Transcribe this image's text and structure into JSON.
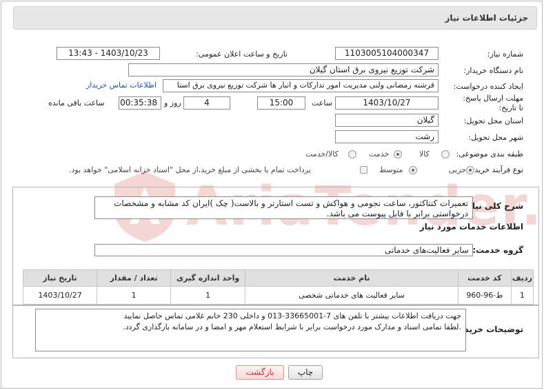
{
  "header": {
    "title": "جزئیات اطلاعات نیاز"
  },
  "form": {
    "need_number_label": "شماره نیاز:",
    "need_number": "1103005104000347",
    "announce_label": "تاریخ و ساعت اعلان عمومی:",
    "announce_value": "1403/10/23 - 13:43",
    "buyer_org_label": "نام دستگاه خریدار:",
    "buyer_org": "شرکت توزیع نیروی برق استان گیلان",
    "creator_label": "ایجاد کننده درخواست:",
    "creator": "فرشته رمضانی ولنی مدیریت امور تدارکات و انبار ها شرکت توزیع نیروی برق استا",
    "contact_link": "اطلاعات تماس خریدار",
    "deadline_label": "مهلت ارسال پاسخ: تا تاریخ:",
    "deadline_date": "1403/10/27",
    "time_label": "ساعت",
    "deadline_time": "15:00",
    "days_value": "4",
    "days_label": "روز و",
    "remaining_time": "00:35:38",
    "remaining_label": "ساعت باقی مانده",
    "province_label": "استان محل تحویل:",
    "province": "گیلان",
    "city_label": "شهر محل تحویل:",
    "city": "رشت",
    "category_label": "طبقه بندی موضوعی:",
    "category_options": [
      "کالا",
      "خدمت",
      "کالا/خدمت"
    ],
    "category_selected": "خدمت",
    "process_label": "نوع فرآیند خرید :",
    "process_options": [
      "جزیی",
      "متوسط"
    ],
    "process_selected": "جزیی",
    "treasury_note": "پرداخت تمام یا بخشی از مبلغ خرید،از محل \"اسناد خزانه اسلامی\" خواهد بود."
  },
  "summary": {
    "label": "شرح کلی نیاز:",
    "text": "تعمیرات کنتاکتور، ساعت نجومی و هواکش و تست استارتر و بالاست( چک )ایران کد مشابه و مشخصات درخواستی برابر با فایل پیوست می باشد."
  },
  "services": {
    "section_title": "اطلاعات خدمات مورد نیاز",
    "group_label": "گروه خدمت:",
    "group_value": "سایر فعالیت‌های خدماتی",
    "columns": [
      "ردیف",
      "کد خدمت",
      "نام خدمت",
      "واحد اندازه گیری",
      "تعداد / مقدار",
      "تاریخ نیاز"
    ],
    "rows": [
      [
        "1",
        "ط-96-960",
        "سایر فعالیت های خدماتی شخصی",
        "1",
        "1",
        "1403/10/27"
      ]
    ]
  },
  "buyer_notes": {
    "label": "توضیحات خریدار:",
    "line1": "جهت دریافت اطلاعات بیشتر با تلفن های 7-33665001-013 و داخلی 230 خانم غلامی تماس حاصل نمایید",
    "line2": ".لطفا تمامی اسناد و مدارک مورد درخواست برابر با شرایط استعلام مهر و امضا و در سامانه بارگذاری گردد."
  },
  "buttons": {
    "print": "چاپ",
    "back": "بازگشت"
  },
  "watermark": {
    "text": "AriaTender.neT"
  },
  "colors": {
    "link": "#1a56b0",
    "back_button_text": "#c03030",
    "watermark": "#c42a1e"
  }
}
